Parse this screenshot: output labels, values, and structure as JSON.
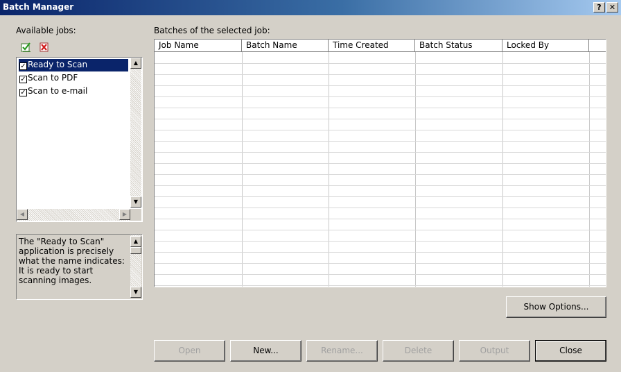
{
  "window": {
    "title": "Batch Manager",
    "help_glyph": "?",
    "close_glyph": "✕"
  },
  "available_jobs": {
    "label": "Available jobs:",
    "toolbar": [
      {
        "icon": "check-all-icon"
      },
      {
        "icon": "uncheck-all-icon"
      }
    ],
    "items": [
      {
        "label": "Ready to Scan",
        "checked": true,
        "selected": true
      },
      {
        "label": "Scan to PDF",
        "checked": true,
        "selected": false
      },
      {
        "label": "Scan to e-mail",
        "checked": true,
        "selected": false
      }
    ],
    "description": "The \"Ready to Scan\" application is precisely what the name indicates: It is ready to start scanning images."
  },
  "batches": {
    "label": "Batches of the selected job:",
    "columns": [
      "Job Name",
      "Batch Name",
      "Time Created",
      "Batch Status",
      "Locked By"
    ],
    "rows": []
  },
  "buttons": {
    "show_options": "Show Options...",
    "open": "Open",
    "new": "New...",
    "rename": "Rename...",
    "delete": "Delete",
    "output": "Output",
    "close": "Close"
  },
  "scroll": {
    "up": "▲",
    "down": "▼",
    "left": "◀",
    "right": "▶"
  }
}
